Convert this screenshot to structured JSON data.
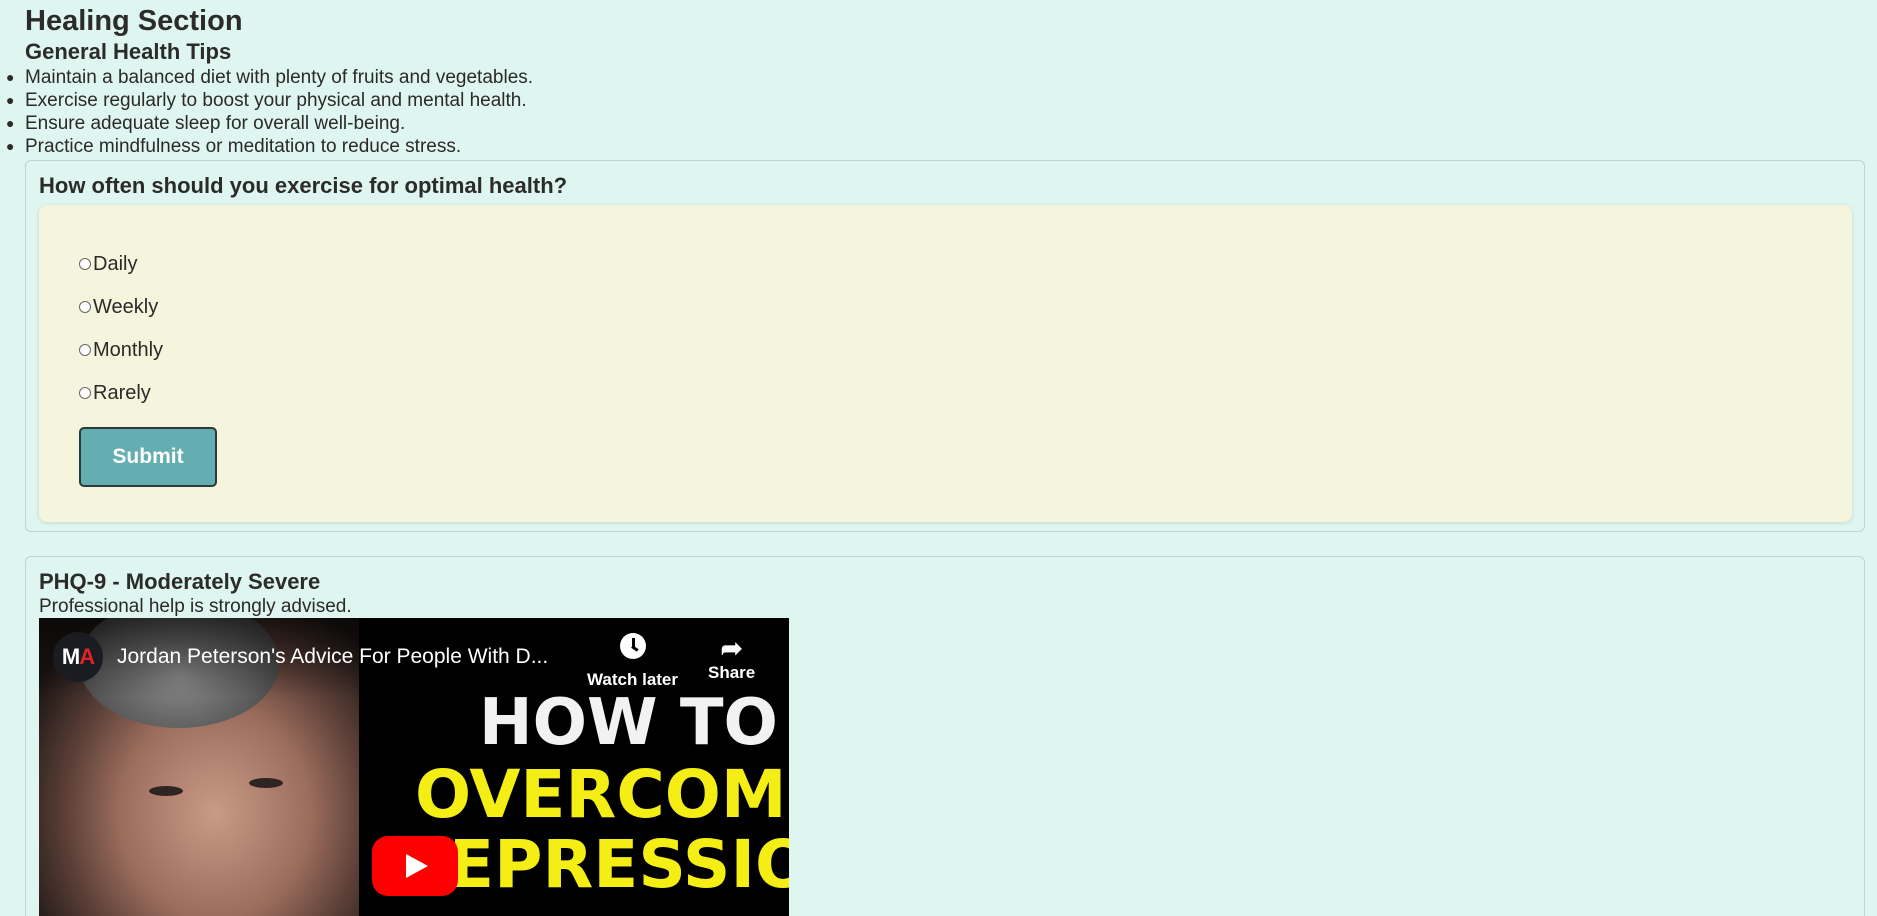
{
  "page": {
    "title": "Healing Section",
    "subtitle": "General Health Tips"
  },
  "tips": [
    "Maintain a balanced diet with plenty of fruits and vegetables.",
    "Exercise regularly to boost your physical and mental health.",
    "Ensure adequate sleep for overall well-being.",
    "Practice mindfulness or meditation to reduce stress."
  ],
  "quiz": {
    "question": "How often should you exercise for optimal health?",
    "options": [
      "Daily",
      "Weekly",
      "Monthly",
      "Rarely"
    ],
    "submit_label": "Submit"
  },
  "phq": {
    "title": "PHQ-9 - Moderately Severe",
    "message": "Professional help is strongly advised."
  },
  "video": {
    "channel_logo_left": "M",
    "channel_logo_right": "A",
    "title": "Jordan Peterson's Advice For People With D...",
    "watch_later_label": "Watch later",
    "share_label": "Share",
    "thumb_line1": "HOW TO",
    "thumb_line2": "OVERCOME",
    "thumb_line3": "EPRESSION"
  },
  "colors": {
    "page_bg": "#dff5ef",
    "panel_bg": "#f4f5dc",
    "button_bg": "#64aeb1",
    "thumb_yellow": "#f5ee14",
    "youtube_red": "#ff0000"
  },
  "icons": {
    "watch_later": "clock-icon",
    "share": "share-arrow-icon",
    "play": "play-icon"
  }
}
